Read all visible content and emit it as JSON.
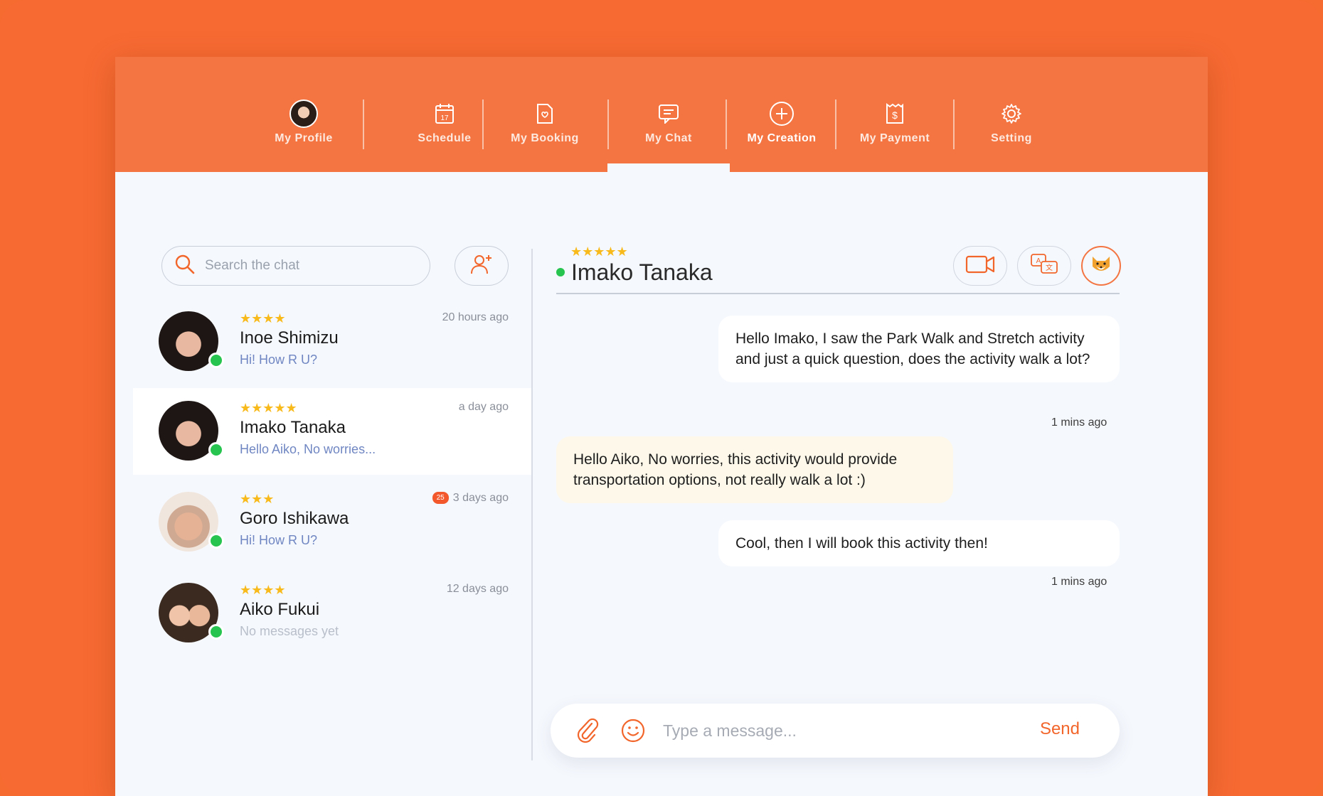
{
  "nav": {
    "items": [
      {
        "label": "My Profile",
        "icon": "avatar"
      },
      {
        "label": "Schedule",
        "icon": "calendar-icon",
        "icon_text": "17"
      },
      {
        "label": "My Booking",
        "icon": "booking-icon"
      },
      {
        "label": "My Chat",
        "icon": "chat-icon",
        "active": true
      },
      {
        "label": "My Creation",
        "icon": "plus-circle-icon"
      },
      {
        "label": "My Payment",
        "icon": "payment-icon"
      },
      {
        "label": "Setting",
        "icon": "gear-icon"
      }
    ]
  },
  "search": {
    "placeholder": "Search the chat",
    "value": ""
  },
  "contacts": [
    {
      "name": "Inoe Shimizu",
      "stars": "★★★★",
      "preview": "Hi! How R U?",
      "time": "20 hours ago",
      "badge": ""
    },
    {
      "name": "Imako Tanaka",
      "stars": "★★★★★",
      "preview": "Hello Aiko, No worries...",
      "time": "a day ago",
      "badge": "",
      "active": true
    },
    {
      "name": "Goro Ishikawa",
      "stars": "★★★",
      "preview": "Hi! How R U?",
      "time": "3 days ago",
      "badge": "25"
    },
    {
      "name": "Aiko Fukui",
      "stars": "★★★★",
      "preview": "No messages yet",
      "time": "12 days ago",
      "badge": ""
    }
  ],
  "chat": {
    "name": "Imako Tanaka",
    "stars": "★★★★★",
    "messages": [
      {
        "text": "Hello Imako, I saw the Park Walk and Stretch activity and just a quick question, does the activity walk a lot?",
        "time": "1 mins ago",
        "direction": "out"
      },
      {
        "text": "Hello Aiko, No worries, this activity would provide transportation options, not really walk a lot :)",
        "time": "",
        "direction": "in"
      },
      {
        "text": "Cool, then I will book this activity then!",
        "time": "1 mins ago",
        "direction": "out"
      }
    ]
  },
  "composer": {
    "placeholder": "Type a message...",
    "value": "",
    "send_label": "Send"
  },
  "colors": {
    "brand": "#f47542",
    "online": "#27c54f",
    "star": "#f8b91a",
    "link": "#6f86c2"
  }
}
